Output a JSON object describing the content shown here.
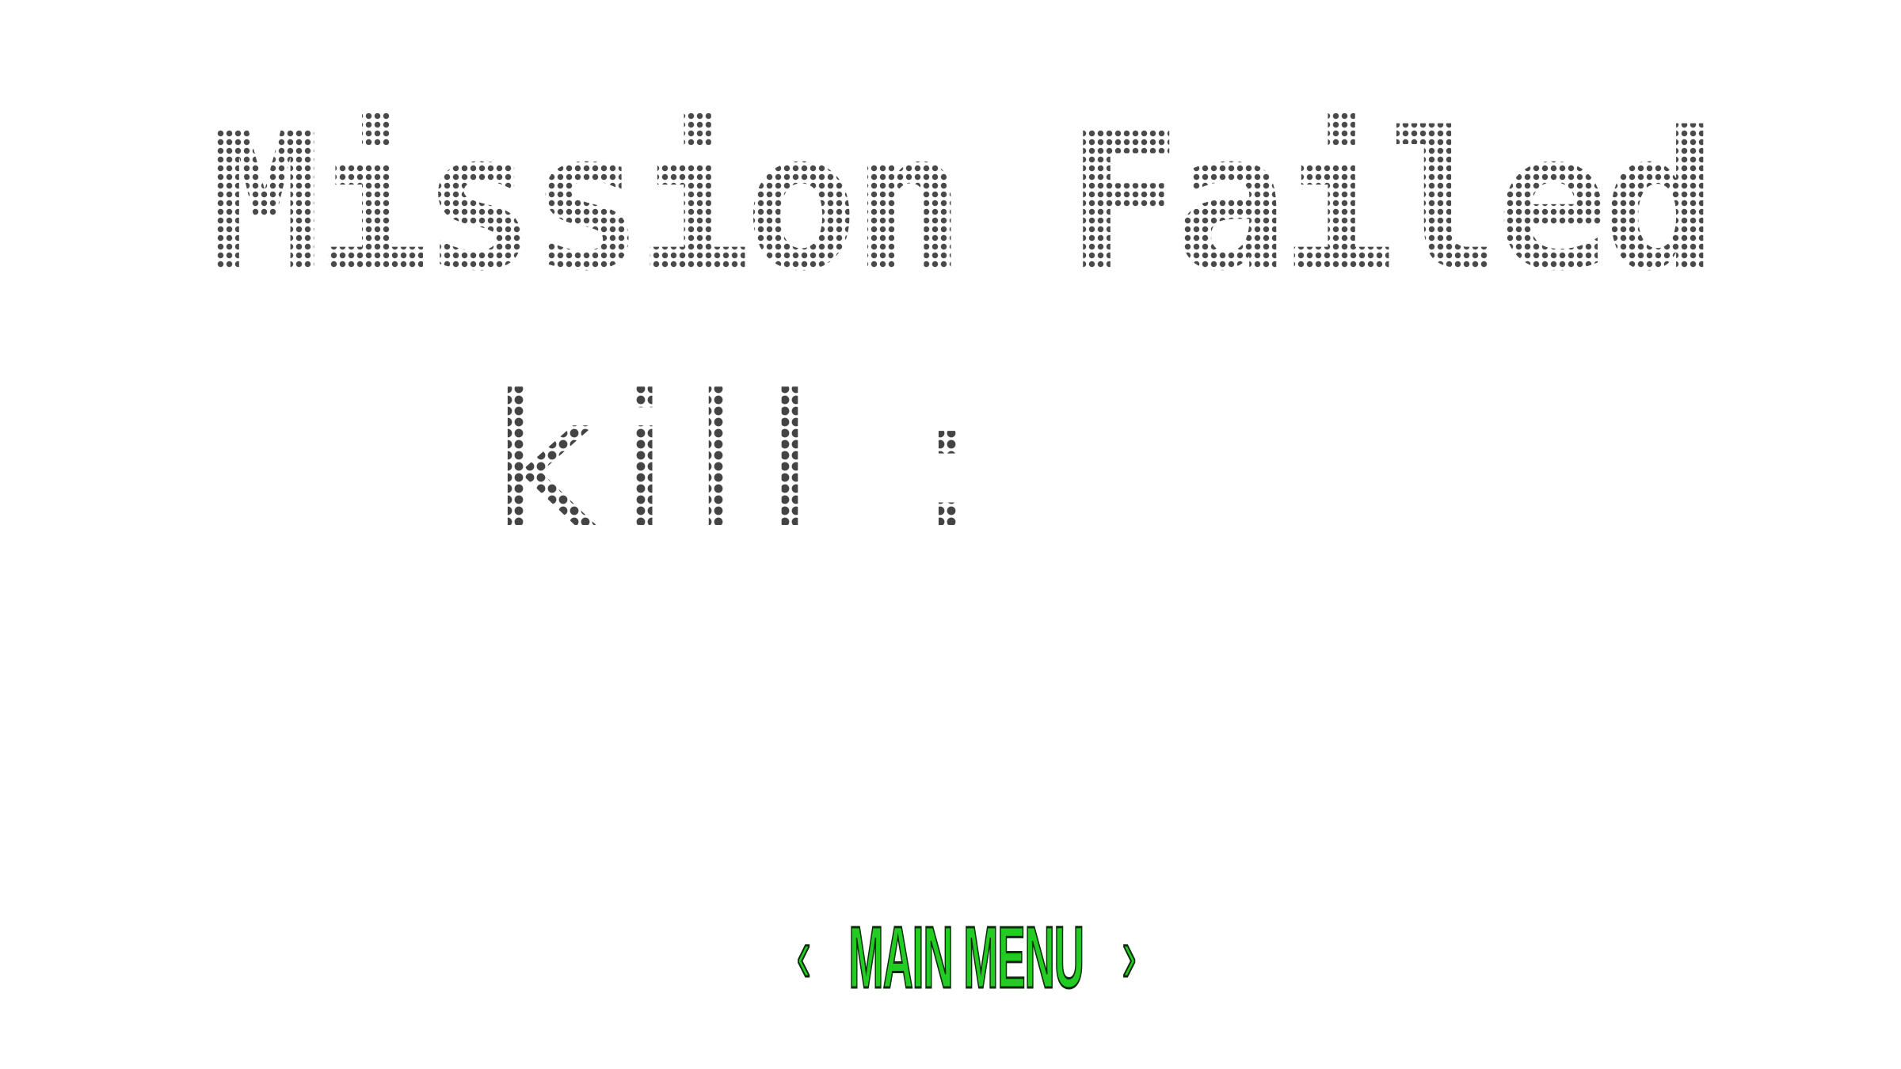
{
  "game_over": {
    "title": "Mission Failed",
    "kill_label": "kill :",
    "kill_value": ""
  },
  "menu": {
    "main_menu_label": "MAIN MENU",
    "left_chevron": "‹",
    "right_chevron": "›"
  },
  "colors": {
    "background": "#ffffff",
    "text_dots": "#4a4a4a",
    "button_fill": "#22cc22",
    "button_outline": "#0d2b0d"
  }
}
